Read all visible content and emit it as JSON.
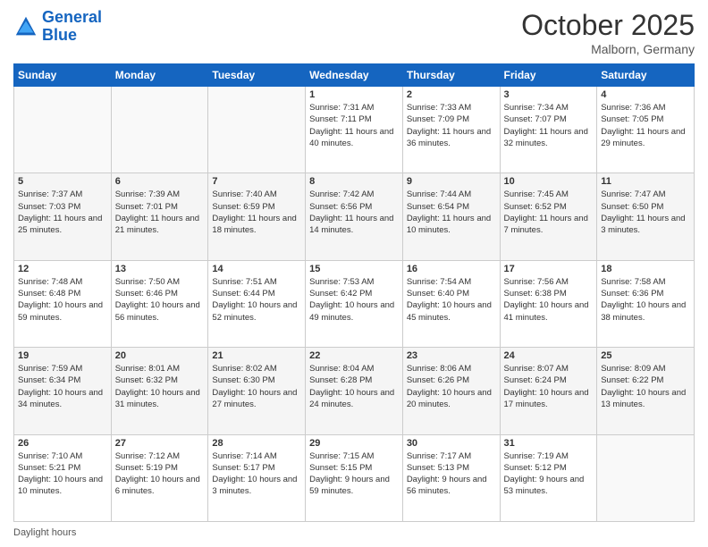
{
  "header": {
    "logo_line1": "General",
    "logo_line2": "Blue",
    "month": "October 2025",
    "location": "Malborn, Germany"
  },
  "days_of_week": [
    "Sunday",
    "Monday",
    "Tuesday",
    "Wednesday",
    "Thursday",
    "Friday",
    "Saturday"
  ],
  "weeks": [
    [
      {
        "day": "",
        "sunrise": "",
        "sunset": "",
        "daylight": ""
      },
      {
        "day": "",
        "sunrise": "",
        "sunset": "",
        "daylight": ""
      },
      {
        "day": "",
        "sunrise": "",
        "sunset": "",
        "daylight": ""
      },
      {
        "day": "1",
        "sunrise": "Sunrise: 7:31 AM",
        "sunset": "Sunset: 7:11 PM",
        "daylight": "Daylight: 11 hours and 40 minutes."
      },
      {
        "day": "2",
        "sunrise": "Sunrise: 7:33 AM",
        "sunset": "Sunset: 7:09 PM",
        "daylight": "Daylight: 11 hours and 36 minutes."
      },
      {
        "day": "3",
        "sunrise": "Sunrise: 7:34 AM",
        "sunset": "Sunset: 7:07 PM",
        "daylight": "Daylight: 11 hours and 32 minutes."
      },
      {
        "day": "4",
        "sunrise": "Sunrise: 7:36 AM",
        "sunset": "Sunset: 7:05 PM",
        "daylight": "Daylight: 11 hours and 29 minutes."
      }
    ],
    [
      {
        "day": "5",
        "sunrise": "Sunrise: 7:37 AM",
        "sunset": "Sunset: 7:03 PM",
        "daylight": "Daylight: 11 hours and 25 minutes."
      },
      {
        "day": "6",
        "sunrise": "Sunrise: 7:39 AM",
        "sunset": "Sunset: 7:01 PM",
        "daylight": "Daylight: 11 hours and 21 minutes."
      },
      {
        "day": "7",
        "sunrise": "Sunrise: 7:40 AM",
        "sunset": "Sunset: 6:59 PM",
        "daylight": "Daylight: 11 hours and 18 minutes."
      },
      {
        "day": "8",
        "sunrise": "Sunrise: 7:42 AM",
        "sunset": "Sunset: 6:56 PM",
        "daylight": "Daylight: 11 hours and 14 minutes."
      },
      {
        "day": "9",
        "sunrise": "Sunrise: 7:44 AM",
        "sunset": "Sunset: 6:54 PM",
        "daylight": "Daylight: 11 hours and 10 minutes."
      },
      {
        "day": "10",
        "sunrise": "Sunrise: 7:45 AM",
        "sunset": "Sunset: 6:52 PM",
        "daylight": "Daylight: 11 hours and 7 minutes."
      },
      {
        "day": "11",
        "sunrise": "Sunrise: 7:47 AM",
        "sunset": "Sunset: 6:50 PM",
        "daylight": "Daylight: 11 hours and 3 minutes."
      }
    ],
    [
      {
        "day": "12",
        "sunrise": "Sunrise: 7:48 AM",
        "sunset": "Sunset: 6:48 PM",
        "daylight": "Daylight: 10 hours and 59 minutes."
      },
      {
        "day": "13",
        "sunrise": "Sunrise: 7:50 AM",
        "sunset": "Sunset: 6:46 PM",
        "daylight": "Daylight: 10 hours and 56 minutes."
      },
      {
        "day": "14",
        "sunrise": "Sunrise: 7:51 AM",
        "sunset": "Sunset: 6:44 PM",
        "daylight": "Daylight: 10 hours and 52 minutes."
      },
      {
        "day": "15",
        "sunrise": "Sunrise: 7:53 AM",
        "sunset": "Sunset: 6:42 PM",
        "daylight": "Daylight: 10 hours and 49 minutes."
      },
      {
        "day": "16",
        "sunrise": "Sunrise: 7:54 AM",
        "sunset": "Sunset: 6:40 PM",
        "daylight": "Daylight: 10 hours and 45 minutes."
      },
      {
        "day": "17",
        "sunrise": "Sunrise: 7:56 AM",
        "sunset": "Sunset: 6:38 PM",
        "daylight": "Daylight: 10 hours and 41 minutes."
      },
      {
        "day": "18",
        "sunrise": "Sunrise: 7:58 AM",
        "sunset": "Sunset: 6:36 PM",
        "daylight": "Daylight: 10 hours and 38 minutes."
      }
    ],
    [
      {
        "day": "19",
        "sunrise": "Sunrise: 7:59 AM",
        "sunset": "Sunset: 6:34 PM",
        "daylight": "Daylight: 10 hours and 34 minutes."
      },
      {
        "day": "20",
        "sunrise": "Sunrise: 8:01 AM",
        "sunset": "Sunset: 6:32 PM",
        "daylight": "Daylight: 10 hours and 31 minutes."
      },
      {
        "day": "21",
        "sunrise": "Sunrise: 8:02 AM",
        "sunset": "Sunset: 6:30 PM",
        "daylight": "Daylight: 10 hours and 27 minutes."
      },
      {
        "day": "22",
        "sunrise": "Sunrise: 8:04 AM",
        "sunset": "Sunset: 6:28 PM",
        "daylight": "Daylight: 10 hours and 24 minutes."
      },
      {
        "day": "23",
        "sunrise": "Sunrise: 8:06 AM",
        "sunset": "Sunset: 6:26 PM",
        "daylight": "Daylight: 10 hours and 20 minutes."
      },
      {
        "day": "24",
        "sunrise": "Sunrise: 8:07 AM",
        "sunset": "Sunset: 6:24 PM",
        "daylight": "Daylight: 10 hours and 17 minutes."
      },
      {
        "day": "25",
        "sunrise": "Sunrise: 8:09 AM",
        "sunset": "Sunset: 6:22 PM",
        "daylight": "Daylight: 10 hours and 13 minutes."
      }
    ],
    [
      {
        "day": "26",
        "sunrise": "Sunrise: 7:10 AM",
        "sunset": "Sunset: 5:21 PM",
        "daylight": "Daylight: 10 hours and 10 minutes."
      },
      {
        "day": "27",
        "sunrise": "Sunrise: 7:12 AM",
        "sunset": "Sunset: 5:19 PM",
        "daylight": "Daylight: 10 hours and 6 minutes."
      },
      {
        "day": "28",
        "sunrise": "Sunrise: 7:14 AM",
        "sunset": "Sunset: 5:17 PM",
        "daylight": "Daylight: 10 hours and 3 minutes."
      },
      {
        "day": "29",
        "sunrise": "Sunrise: 7:15 AM",
        "sunset": "Sunset: 5:15 PM",
        "daylight": "Daylight: 9 hours and 59 minutes."
      },
      {
        "day": "30",
        "sunrise": "Sunrise: 7:17 AM",
        "sunset": "Sunset: 5:13 PM",
        "daylight": "Daylight: 9 hours and 56 minutes."
      },
      {
        "day": "31",
        "sunrise": "Sunrise: 7:19 AM",
        "sunset": "Sunset: 5:12 PM",
        "daylight": "Daylight: 9 hours and 53 minutes."
      },
      {
        "day": "",
        "sunrise": "",
        "sunset": "",
        "daylight": ""
      }
    ]
  ],
  "footer": {
    "text": "Daylight hours"
  }
}
